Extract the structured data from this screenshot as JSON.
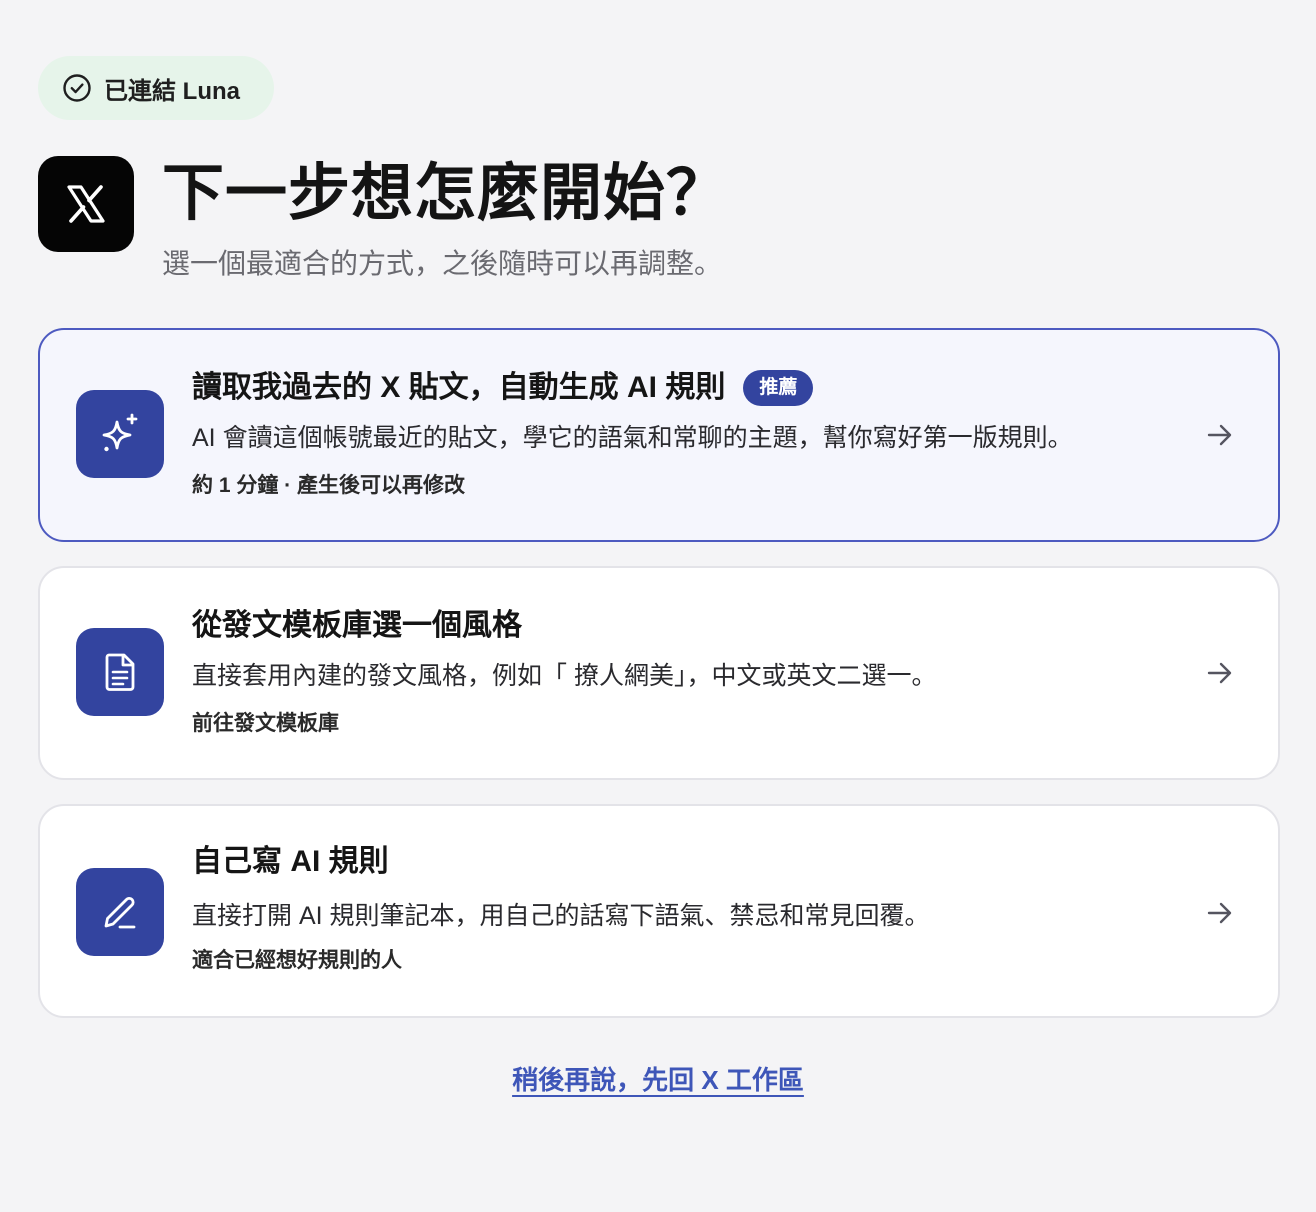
{
  "status_badge": {
    "icon": "check-circle-icon",
    "text": "已連結 Luna",
    "background": "#e6f4ea"
  },
  "platform": {
    "logo": "x-logo-icon"
  },
  "header": {
    "title": "下一步想怎麼開始？",
    "subtitle": "選一個最適合的方式，之後隨時可以再調整。"
  },
  "options": [
    {
      "icon": "sparkle-icon",
      "title": "讀取我過去的 X 貼文，自動生成 AI 規則",
      "tag": "推薦",
      "description": "AI 會讀這個帳號最近的貼文，學它的語氣和常聊的主題，幫你寫好第一版規則。",
      "note": "約 1 分鐘 · 產生後可以再修改",
      "arrow": "arrow-right-icon"
    },
    {
      "icon": "document-icon",
      "title": "從發文模板庫選一個風格",
      "description": "直接套用內建的發文風格，例如「 撩人網美」，中文或英文二選一。",
      "note": "前往發文模板庫",
      "arrow": "arrow-right-icon"
    },
    {
      "icon": "pencil-icon",
      "title": "自己寫 AI 規則",
      "description": "直接打開 AI 規則筆記本，用自己的話寫下語氣、禁忌和常見回覆。",
      "note": "適合已經想好規則的人",
      "arrow": "arrow-right-icon"
    }
  ],
  "footer": {
    "later_link": "稍後再說，先回 X 工作區"
  },
  "colors": {
    "accent": "#33449f",
    "link": "#3e56b8",
    "recommended_border": "#4d5ac0",
    "page_background": "#f4f4f6"
  }
}
